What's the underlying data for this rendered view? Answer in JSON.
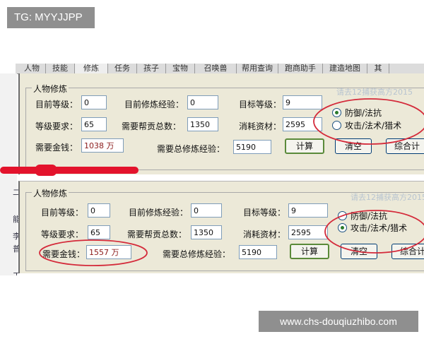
{
  "watermark_top_left": "TG: MYYJJPP",
  "watermark_bottom_right": "www.chs-douqiuzhibo.com",
  "tabs": [
    "人物",
    "技能",
    "修炼",
    "任务",
    "孩子",
    "宝物",
    "召唤兽",
    "帮用查询",
    "跑商助手",
    "建造地图",
    "其"
  ],
  "faint_watermark": "请去12捕获高方2015",
  "panel_top": {
    "group_title": "人物修炼",
    "current_level_label": "目前等级：",
    "current_level_value": "0",
    "current_exp_label": "目前修炼经验：",
    "current_exp_value": "0",
    "target_level_label": "目标等级：",
    "target_level_value": "9",
    "req_level_label": "等级要求：",
    "req_level_value": "65",
    "contribution_label": "需要帮贡总数：",
    "contribution_value": "1350",
    "materials_label": "消耗资材：",
    "materials_value": "2595",
    "money_label": "需要金钱：",
    "money_value": "1038 万",
    "total_exp_label": "需要总修炼经验：",
    "total_exp_value": "5190",
    "calc_button": "计算",
    "clear_button": "清空",
    "combined_button": "综合计",
    "radio_defense": "防御/法抗",
    "radio_attack": "攻击/法术/猎术"
  },
  "panel_bottom": {
    "group_title": "人物修炼",
    "current_level_label": "目前等级：",
    "current_level_value": "0",
    "current_exp_label": "目前修炼经验：",
    "current_exp_value": "0",
    "target_level_label": "目标等级：",
    "target_level_value": "9",
    "req_level_label": "等级要求：",
    "req_level_value": "65",
    "contribution_label": "需要帮贡总数：",
    "contribution_value": "1350",
    "materials_label": "消耗资材：",
    "materials_value": "2595",
    "money_label": "需要金钱：",
    "money_value": "1557 万",
    "total_exp_label": "需要总修炼经验：",
    "total_exp_value": "5190",
    "calc_button": "计算",
    "clear_button": "清空",
    "combined_button": "综合计",
    "radio_defense": "防御/法抗",
    "radio_attack": "攻击/法术/猎术"
  },
  "side_marks": [
    "二",
    "能",
    "李",
    "普",
    "工"
  ],
  "selected_radio": {
    "top": "defense",
    "bottom": "attack"
  },
  "colors": {
    "annotation_red": "#d42a3a",
    "strike_red": "#e3132c",
    "panel_bg": "#ece9d8"
  }
}
